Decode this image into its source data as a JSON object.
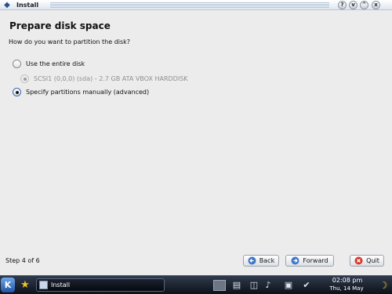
{
  "window": {
    "title": "Install",
    "buttons": {
      "help": "?",
      "minimize": "v",
      "maximize": "^",
      "close": "x"
    }
  },
  "main": {
    "heading": "Prepare disk space",
    "question": "How do you want to partition the disk?",
    "options": [
      {
        "label": "Use the entire disk",
        "selected": false,
        "enabled": true
      },
      {
        "label": "SCSI1 (0,0,0) (sda) - 2.7 GB ATA VBOX HARDDISK",
        "selected": true,
        "enabled": false
      },
      {
        "label": "Specify partitions manually (advanced)",
        "selected": true,
        "enabled": true
      }
    ]
  },
  "footer": {
    "step": "Step 4 of 6",
    "back": "Back",
    "forward": "Forward",
    "quit": "Quit"
  },
  "taskbar": {
    "task_label": "Install",
    "clock_time": "02:08 pm",
    "clock_date": "Thu, 14 May",
    "icons": [
      "kmenu-icon",
      "home-folder-icon",
      "desktop-pager-icon",
      "network-icon",
      "volume-icon",
      "klipper-icon",
      "usb-device-icon",
      "night-moon-icon"
    ]
  },
  "colors": {
    "accent": "#3b66b5",
    "taskbar": "#0e1219",
    "background": "#ececec"
  }
}
